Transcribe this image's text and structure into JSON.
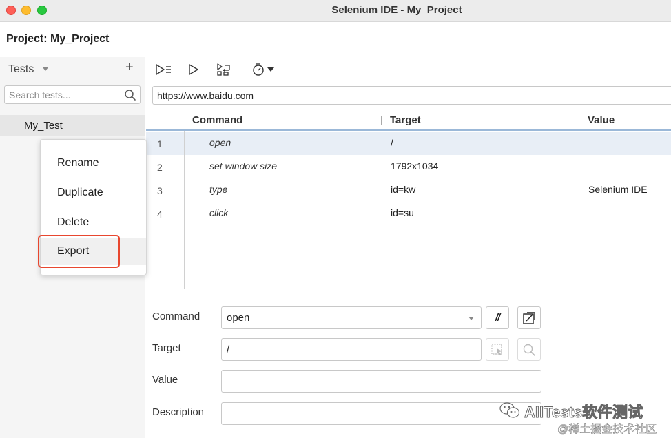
{
  "window": {
    "title": "Selenium IDE - My_Project"
  },
  "project": {
    "label": "Project:  My_Project"
  },
  "sidebar": {
    "tests_header": "Tests",
    "add_label": "+",
    "search_placeholder": "Search tests...",
    "items": [
      {
        "label": "My_Test"
      }
    ]
  },
  "context_menu": {
    "items": [
      {
        "label": "Rename"
      },
      {
        "label": "Duplicate"
      },
      {
        "label": "Delete"
      },
      {
        "label": "Export"
      }
    ],
    "highlighted": "Export"
  },
  "toolbar": {
    "icons": [
      "run-all-icon",
      "run-icon",
      "step-icon",
      "speed-icon"
    ],
    "base_url": "https://www.baidu.com"
  },
  "table": {
    "headers": {
      "command": "Command",
      "target": "Target",
      "value": "Value"
    },
    "rows": [
      {
        "num": "1",
        "command": "open",
        "target": "/",
        "value": ""
      },
      {
        "num": "2",
        "command": "set window size",
        "target": "1792x1034",
        "value": ""
      },
      {
        "num": "3",
        "command": "type",
        "target": "id=kw",
        "value": "Selenium IDE"
      },
      {
        "num": "4",
        "command": "click",
        "target": "id=su",
        "value": ""
      }
    ],
    "selected_row": "1"
  },
  "editor": {
    "command_label": "Command",
    "command_value": "open",
    "target_label": "Target",
    "target_value": "/",
    "value_label": "Value",
    "value_value": "",
    "description_label": "Description",
    "description_value": "",
    "comment_glyph": "//"
  },
  "watermark": {
    "main": "AllTests软件测试",
    "sub": "@稀土掘金技术社区"
  },
  "colors": {
    "close": "#fe5f57",
    "minimize": "#febc2e",
    "maximize": "#28c840",
    "highlight_border": "#e8472f",
    "selected_row": "#e8eef6"
  }
}
